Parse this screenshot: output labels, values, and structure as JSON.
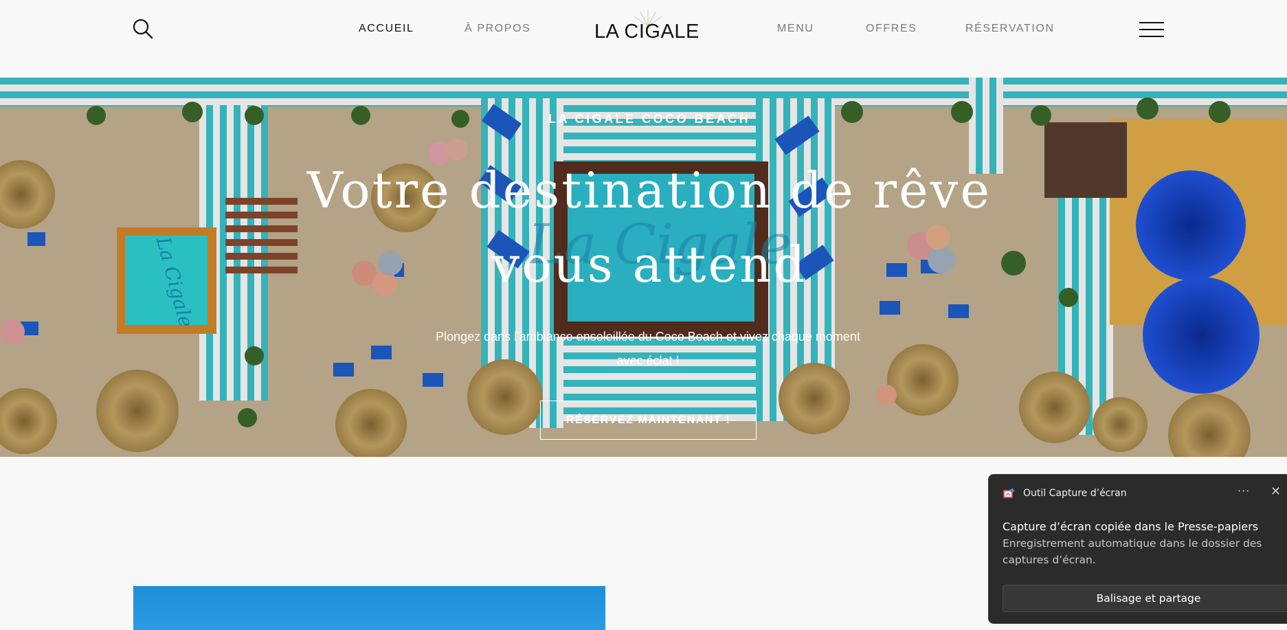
{
  "header": {
    "logo_text": "LA CIGALE",
    "nav": [
      {
        "label": "ACCUEIL",
        "active": true
      },
      {
        "label": "À PROPOS",
        "active": false
      },
      {
        "label": "MENU",
        "active": false
      },
      {
        "label": "OFFRES",
        "active": false
      },
      {
        "label": "RÉSERVATION",
        "active": false
      }
    ],
    "search_icon": "search-icon",
    "menu_icon": "hamburger-menu-icon"
  },
  "hero": {
    "eyebrow": "LA CIGALE COCO BEACH",
    "title": "Votre destination de rêve vous attend",
    "subtitle": "Plongez dans l'ambiance ensoleillée du Coco Beach et vivez chaque moment avec éclat !",
    "cta_label": "RÉSERVEZ MAINTENANT !"
  },
  "toast": {
    "app_name": "Outil Capture d’écran",
    "more_label": "···",
    "close_label": "✕",
    "title": "Capture d’écran copiée dans le Presse-papiers",
    "body": "Enregistrement automatique dans le dossier des captures d’écran.",
    "action_label": "Balisage et partage"
  },
  "colors": {
    "accent_text": "#111111",
    "nav_inactive": "#7a7a7a",
    "page_bg": "#f8f8f8",
    "toast_bg": "#2b2b2b",
    "pool": "#2fd0d8",
    "sand": "#cdb999",
    "umbrella_blue": "#1d4fd8"
  }
}
